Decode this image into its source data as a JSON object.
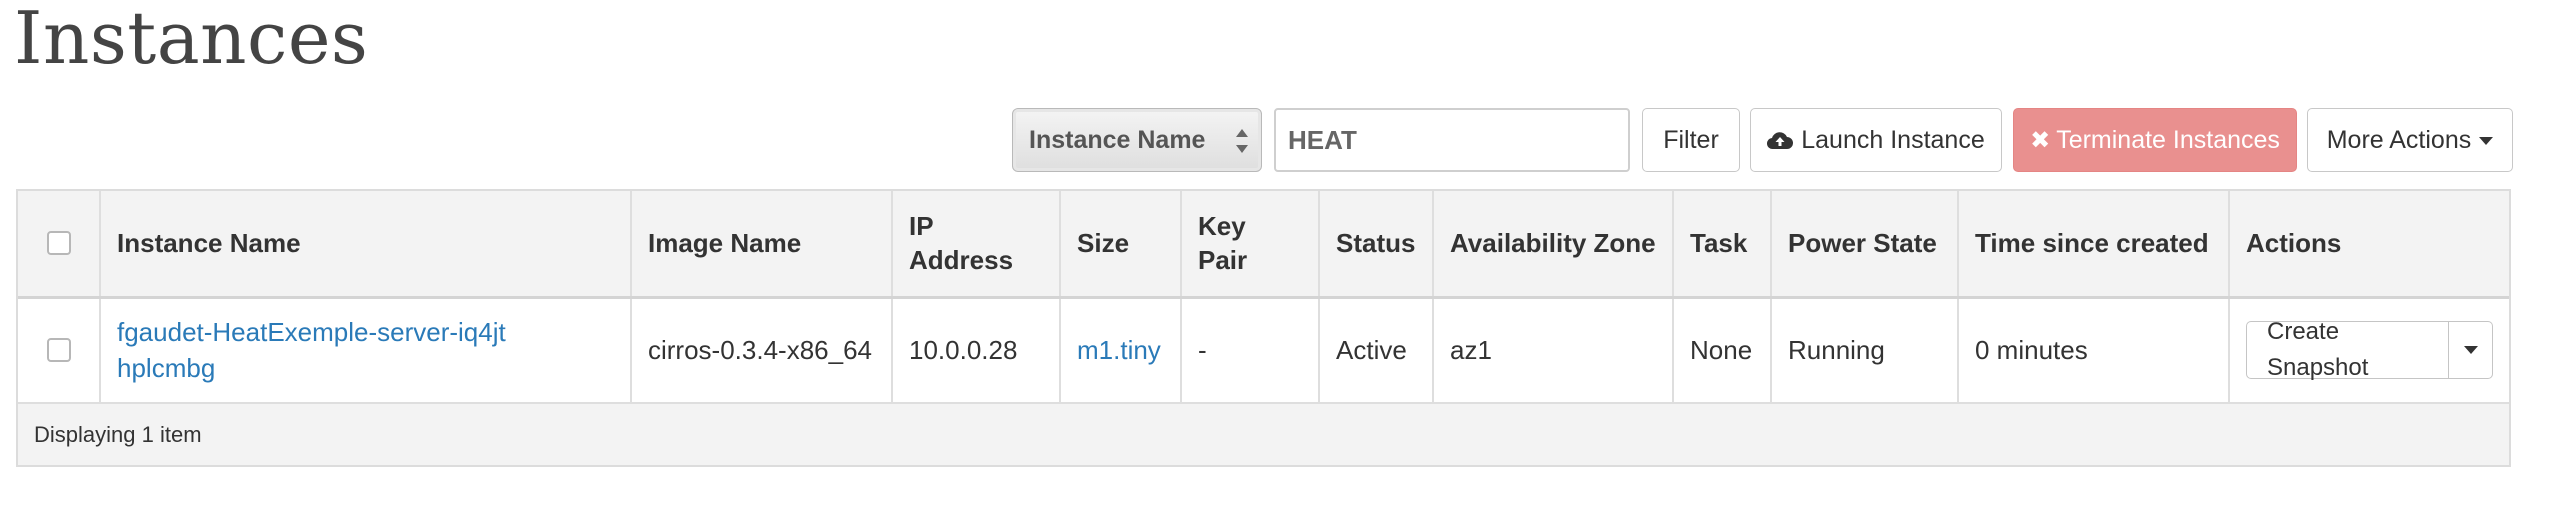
{
  "page": {
    "title": "Instances"
  },
  "toolbar": {
    "filter_field": "Instance Name",
    "search_value": "HEAT",
    "filter_label": "Filter",
    "launch_label": "Launch Instance",
    "terminate_label": "Terminate Instances",
    "more_label": "More Actions",
    "terminate_color": "#e9908f"
  },
  "table": {
    "columns": [
      "Instance Name",
      "Image Name",
      "IP Address",
      "Size",
      "Key Pair",
      "Status",
      "Availability Zone",
      "Task",
      "Power State",
      "Time since created",
      "Actions"
    ],
    "rows": [
      {
        "instance_name": "fgaudet-HeatExemple-server-iq4jthplcmbg",
        "image_name": "cirros-0.3.4-x86_64",
        "ip_address": "10.0.0.28",
        "size": "m1.tiny",
        "key_pair": "-",
        "status": "Active",
        "availability_zone": "az1",
        "task": "None",
        "power_state": "Running",
        "time_since_created": "0 minutes",
        "action_label": "Create Snapshot"
      }
    ],
    "footer": "Displaying 1 item"
  },
  "colors": {
    "link": "#2a7ab8",
    "header_bg": "#f3f3f3"
  }
}
